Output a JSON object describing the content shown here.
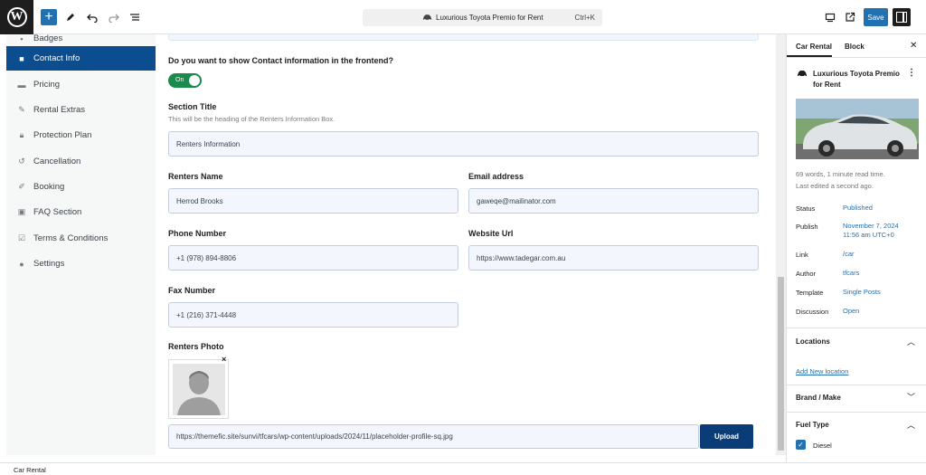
{
  "topbar": {
    "logo": "W",
    "post_title": "Luxurious Toyota Premio for Rent",
    "shortcut": "Ctrl+K",
    "save_label": "Save",
    "icons": [
      "plus-icon",
      "pen-icon",
      "undo-icon",
      "redo-icon",
      "list-view-icon",
      "desktop-icon",
      "external-link-icon",
      "sidebar-toggle-icon"
    ]
  },
  "sidebar": {
    "items": [
      {
        "label": "Badges",
        "icon": "badge-icon"
      },
      {
        "label": "Contact Info",
        "icon": "contact-icon",
        "active": true
      },
      {
        "label": "Pricing",
        "icon": "pricing-icon"
      },
      {
        "label": "Rental Extras",
        "icon": "wrench-icon"
      },
      {
        "label": "Protection Plan",
        "icon": "lock-icon"
      },
      {
        "label": "Cancellation",
        "icon": "cancel-icon"
      },
      {
        "label": "Booking",
        "icon": "booking-icon"
      },
      {
        "label": "FAQ Section",
        "icon": "faq-icon"
      },
      {
        "label": "Terms & Conditions",
        "icon": "checkbox-icon"
      },
      {
        "label": "Settings",
        "icon": "settings-icon"
      }
    ]
  },
  "content": {
    "show_contact_question": "Do you want to show Contact information in the frontend?",
    "toggle_label": "On",
    "section_title_label": "Section Title",
    "section_title_help": "This will be the heading of the Renters Information Box.",
    "section_title_value": "Renters Information",
    "renters_name_label": "Renters Name",
    "renters_name_value": "Herrod Brooks",
    "email_label": "Email address",
    "email_value": "gaweqe@mailinator.com",
    "phone_label": "Phone Number",
    "phone_value": "+1 (978) 894-8806",
    "website_label": "Website Url",
    "website_value": "https://www.tadegar.com.au",
    "fax_label": "Fax Number",
    "fax_value": "+1 (216) 371-4448",
    "photo_label": "Renters Photo",
    "photo_close": "×",
    "photo_url": "https://themefic.site/sunvi/tfcars/wp-content/uploads/2024/11/placeholder-profile-sq.jpg",
    "upload_label": "Upload"
  },
  "inspector": {
    "tabs": [
      "Car Rental",
      "Block"
    ],
    "close": "✕",
    "post_title": "Luxurious Toyota Premio for Rent",
    "more": "⋮",
    "stats": "69 words, 1 minute read time.",
    "last_edited": "Last edited a second ago.",
    "rows": [
      {
        "label": "Status",
        "value": "Published"
      },
      {
        "label": "Publish",
        "value": "November 7, 2024",
        "value2": "11:56 am UTC+0"
      },
      {
        "label": "Link",
        "value": "/car"
      },
      {
        "label": "Author",
        "value": "tfcars"
      },
      {
        "label": "Template",
        "value": "Single Posts"
      },
      {
        "label": "Discussion",
        "value": "Open"
      }
    ],
    "locations_title": "Locations",
    "add_location": "Add New location",
    "brand_title": "Brand / Make",
    "fuel_title": "Fuel Type",
    "fuel_option": "Diesel",
    "fuel_checked": true
  },
  "statusbar": {
    "breadcrumb": "Car Rental"
  },
  "colors": {
    "accent": "#2271b1",
    "sidebar_active": "#0b4d8f",
    "toggle_on": "#1a8a4d",
    "upload": "#0a3d78"
  }
}
